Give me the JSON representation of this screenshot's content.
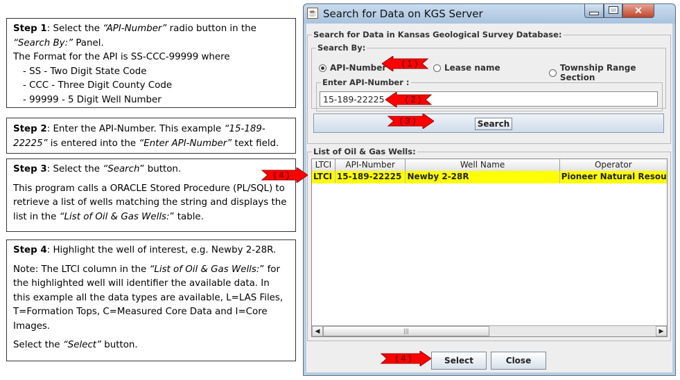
{
  "steps": {
    "step1": {
      "label": "Step 1",
      "text_a": ": Select the ",
      "api_quote": "“API-Number”",
      "text_b": " radio button in the ",
      "searchby_quote": "“Search By:”",
      "text_c": " Panel.",
      "format_line": "The Format for the API is SS-CCC-99999 where",
      "bullets": [
        "- SS - Two Digit State Code",
        "- CCC - Three Digit County Code",
        "- 99999 - 5 Digit Well Number"
      ]
    },
    "step2": {
      "label": "Step 2",
      "text_a": ": Enter the API-Number. This example ",
      "example_quote": "“15-189-22225”",
      "text_b": " is entered into the ",
      "field_quote": "“Enter API-Number”",
      "text_c": " text field."
    },
    "step3": {
      "label": "Step 3",
      "text_a": ": Select the ",
      "search_quote": "“Search",
      "text_b": "” button.",
      "para": "This program calls a ORACLE Stored Procedure (PL/SQL) to retrieve a list of wells matching the string and displays the list in the ",
      "list_quote": "“List of Oil & Gas Wells:",
      "text_c": "” table."
    },
    "step4": {
      "label": "Step 4",
      "text_a": ": Highlight the well of interest, e.g. Newby 2-28R.",
      "note_a": "Note: The LTCI column in the ",
      "list_quote": "“List of Oil & Gas Wells:",
      "note_b": "” for the highlighted well will identifier the available data. In this example all the data types are available, L=LAS Files, T=Formation Tops, C=Measured Core Data and I=Core Images.",
      "select_a": "Select the ",
      "select_quote": "“Select”",
      "select_b": " button."
    }
  },
  "window": {
    "title": "Search for Data on KGS Server",
    "outer_group": "Search for Data in Kansas Geological Survey Database:",
    "searchby_group": "Search By:",
    "radios": [
      {
        "label": "API-Number",
        "selected": true
      },
      {
        "label": "Lease name",
        "selected": false
      },
      {
        "label": "Township Range Section",
        "selected": false
      }
    ],
    "api_group": "Enter API-Number :",
    "api_value": "15-189-22225",
    "search_button": "Search",
    "list_group": "List of Oil & Gas Wells:",
    "columns": [
      "LTCI",
      "API-Number",
      "Well Name",
      "Operator"
    ],
    "rows": [
      {
        "ltci": "LTCI",
        "api": "15-189-22225",
        "well": "Newby 2-28R",
        "operator": "Pioneer Natural Resource"
      }
    ],
    "select_button": "Select",
    "close_button": "Close"
  },
  "callouts": [
    "( 1 )",
    "( 2 )",
    "( 3 )",
    "( 4 )",
    "( 4 )"
  ],
  "colors": {
    "highlight_row": "#ffff00",
    "callout_arrow": "#ff0000",
    "title_bar": "#b9cde3"
  },
  "icons": [
    "java-icon",
    "minimize-icon",
    "maximize-icon",
    "close-icon",
    "scroll-left-icon",
    "scroll-right-icon"
  ]
}
